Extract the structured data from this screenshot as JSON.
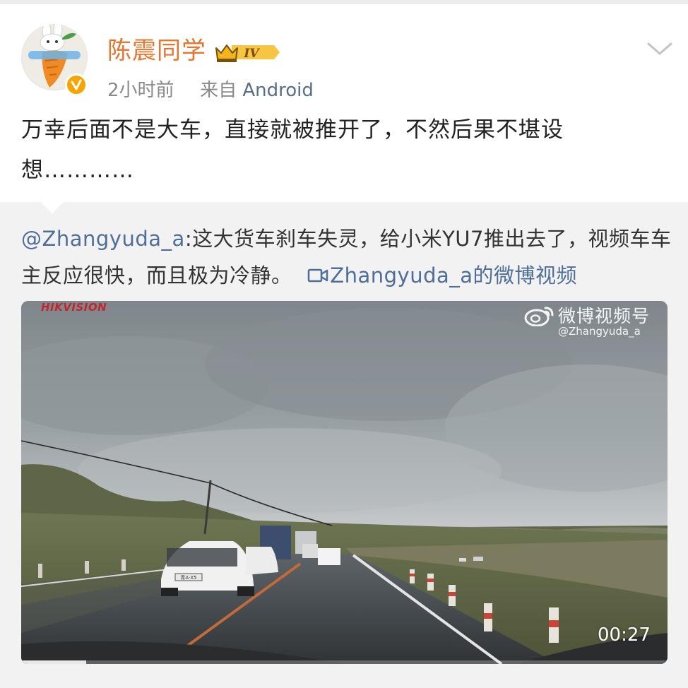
{
  "post": {
    "username": "陈震同学",
    "rank_badge": "IV",
    "time": "2小时前",
    "source_prefix": "来自",
    "source": "Android",
    "text": "万幸后面不是大车，直接就被推开了，不然后果不堪设想…………"
  },
  "repost": {
    "mention": "@Zhangyuda_a",
    "text": ":这大货车刹车失灵，给小米YU7推出去了，视频车车主反应很快，而且极为冷静。",
    "video_link": "Zhangyuda_a的微博视频"
  },
  "video": {
    "camera_brand": "HIKVISION",
    "watermark_title": "微博视频号",
    "watermark_user": "@Zhangyuda_a",
    "duration": "00:27",
    "progress_fraction": 0.1,
    "plate_text": "青A·X5"
  },
  "icons": {
    "avatar": "carrot-avatar-icon",
    "verified": "verified-v-icon",
    "rank": "crown-icon",
    "menu": "chevron-down-icon",
    "video": "video-camera-icon",
    "weibo": "weibo-logo-icon"
  },
  "colors": {
    "username": "#e6752f",
    "link": "#4e6e98",
    "verified": "#f7a400",
    "hik_red": "#c0262c"
  }
}
